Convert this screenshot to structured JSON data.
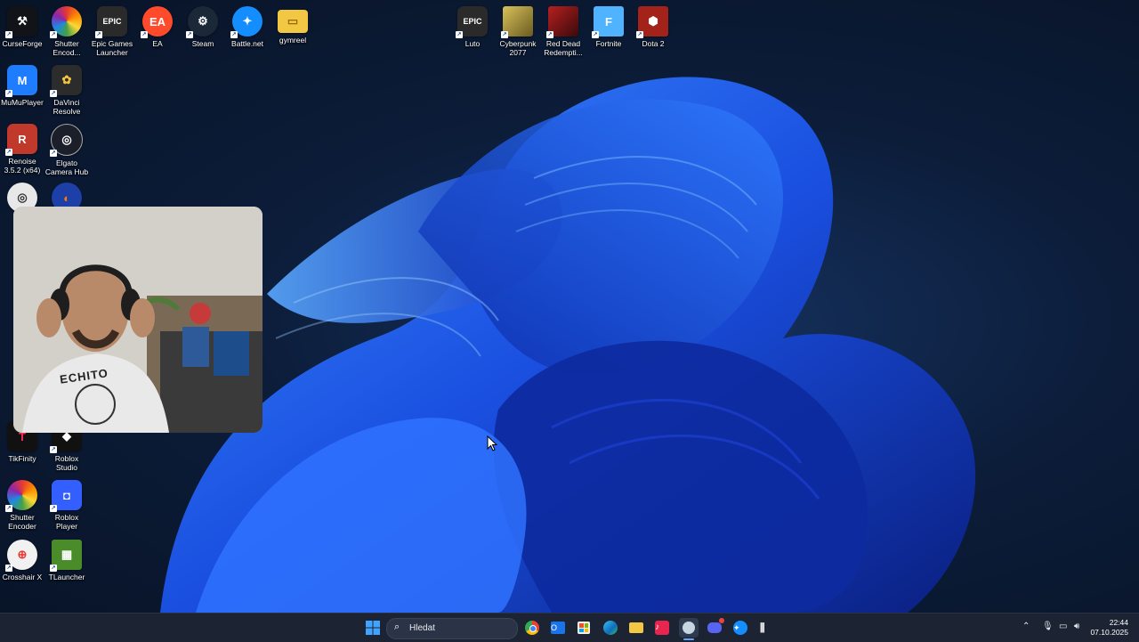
{
  "desktop": {
    "left_icons": [
      {
        "label": "CurseForge",
        "icon": "curseforge-icon",
        "color": "#111318"
      },
      {
        "label": "Shutter Encod...",
        "icon": "shutter-encoder-icon",
        "color": "#d93a2b"
      },
      {
        "label": "Epic Games Launcher",
        "icon": "epic-games-icon",
        "color": "#2a2a2a"
      },
      {
        "label": "EA",
        "icon": "ea-icon",
        "color": "#ff4b2b"
      },
      {
        "label": "Steam",
        "icon": "steam-icon",
        "color": "#1b2838"
      },
      {
        "label": "Battle.net",
        "icon": "battlenet-icon",
        "color": "#148eff"
      },
      {
        "label": "gymreel",
        "icon": "folder-icon",
        "color": "#f2c744"
      },
      {
        "label": "MuMuPlayer",
        "icon": "mumuplayer-icon",
        "color": "#1e7dff"
      },
      {
        "label": "DaVinci Resolve",
        "icon": "davinci-resolve-icon",
        "color": "#2c2c2c"
      },
      {
        "label": "Renoise 3.5.2 (x64)",
        "icon": "renoise-icon",
        "color": "#c0392b"
      },
      {
        "label": "Elgato Camera Hub",
        "icon": "elgato-icon",
        "color": "#1b1f2a"
      },
      {
        "label": "TikFinity",
        "icon": "tikfinity-icon",
        "color": "#111"
      },
      {
        "label": "Roblox Studio",
        "icon": "roblox-studio-icon",
        "color": "#111"
      },
      {
        "label": "Shutter Encoder",
        "icon": "shutter-encoder-icon",
        "color": "#d93a2b"
      },
      {
        "label": "Roblox Player",
        "icon": "roblox-player-icon",
        "color": "#335fff"
      },
      {
        "label": "Crosshair X",
        "icon": "crosshair-x-icon",
        "color": "#f1f1f1"
      },
      {
        "label": "TLauncher",
        "icon": "tlauncher-icon",
        "color": "#4a8c2a"
      }
    ],
    "top_icons": [
      {
        "label": "Luto",
        "icon": "epic-games-icon",
        "color": "#2a2a2a"
      },
      {
        "label": "Cyberpunk 2077",
        "icon": "cyberpunk-icon",
        "color": "#c9b14a"
      },
      {
        "label": "Red Dead Redempti...",
        "icon": "red-dead-icon",
        "color": "#8b1a1a"
      },
      {
        "label": "Fortnite",
        "icon": "fortnite-icon",
        "color": "#4fb3ff"
      },
      {
        "label": "Dota 2",
        "icon": "dota2-icon",
        "color": "#a3231a"
      }
    ],
    "glyphs": {
      "curseforge": "⚒",
      "shutter": "◉",
      "epic": "EPIC",
      "ea": "EA",
      "steam": "⚙",
      "battlenet": "✦",
      "folder": "▭",
      "mumu": "M",
      "davinci": "✿",
      "renoise": "R",
      "elgato": "◎",
      "tikfinity": "T",
      "roblox_studio": "◆",
      "roblox": "◘",
      "crosshair": "⊕",
      "tlauncher": "▦",
      "fortnite": "F",
      "dota": "⬢"
    }
  },
  "webcam": {
    "shirt_text": "ECHITO"
  },
  "taskbar": {
    "search_placeholder": "Hledat",
    "apps": [
      {
        "name": "chrome-icon",
        "color": "#e8eaed"
      },
      {
        "name": "outlook-icon",
        "color": "#1a73e8"
      },
      {
        "name": "store-icon",
        "color": "#3a3a3a"
      },
      {
        "name": "edge-icon",
        "color": "#1ba1e2"
      },
      {
        "name": "file-explorer-icon",
        "color": "#f2c744"
      },
      {
        "name": "tiktok-icon",
        "color": "#e8254f"
      },
      {
        "name": "steam-taskbar-icon",
        "color": "#2a3a55"
      },
      {
        "name": "discord-icon",
        "color": "#5865f2"
      },
      {
        "name": "battlenet-taskbar-icon",
        "color": "#148eff"
      },
      {
        "name": "app-icon",
        "color": "#303a4c"
      }
    ],
    "clock_time": "22:44",
    "clock_date": "07.10.2025"
  }
}
